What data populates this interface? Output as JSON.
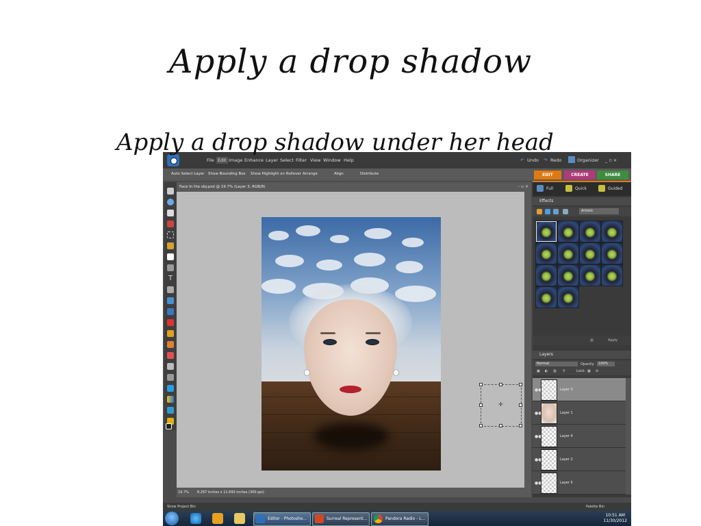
{
  "slide": {
    "title": "Apply a drop shadow",
    "subtitle": "Apply a drop shadow under her head"
  },
  "app": {
    "menu": [
      "File",
      "Edit",
      "Image",
      "Enhance",
      "Layer",
      "Select",
      "Filter",
      "View",
      "Window",
      "Help"
    ],
    "undo": "Undo",
    "redo": "Redo",
    "organizer": "Organizer",
    "win_controls": "_ ▫ ×"
  },
  "options_bar": {
    "auto_select": "Auto Select Layer",
    "show_bounding": "Show Bounding Box",
    "show_highlight": "Show Highlight on Rollover",
    "arrange": "Arrange",
    "align": "Align",
    "distribute": "Distribute"
  },
  "mode_tabs": {
    "edit": "EDIT",
    "create": "CREATE",
    "share": "SHARE"
  },
  "document": {
    "title": "Face In the sky.psd @ 19.7% (Layer 3, RGB/8)",
    "controls": "– ▫ ×",
    "zoom": "19.7%",
    "doc_size": "8.267 inches x 11.693 inches (300 ppi)"
  },
  "panel": {
    "modes": {
      "full": "Full",
      "quick": "Quick",
      "guided": "Guided"
    },
    "effects_header": "Effects",
    "effects_filter": "Artistic",
    "apply": "Apply",
    "layers_header": "Layers",
    "blend_mode": "Normal",
    "opacity_label": "Opacity:",
    "opacity_value": "100%",
    "lock_label": "Lock:",
    "layers": [
      {
        "name": "Layer 3",
        "selected": true,
        "thumb": "transparent"
      },
      {
        "name": "Layer 1",
        "selected": false,
        "thumb": "face"
      },
      {
        "name": "Layer 4",
        "selected": false,
        "thumb": "transparent"
      },
      {
        "name": "Layer 2",
        "selected": false,
        "thumb": "transparent"
      },
      {
        "name": "Layer 5",
        "selected": false,
        "thumb": "transparent"
      }
    ]
  },
  "bottom": {
    "project_bin": "Show Project Bin",
    "palette_bin": "Palette Bin"
  },
  "taskbar": {
    "tasks": [
      "Editor - Photosho...",
      "Surreal Represent...",
      "Pandora Radio - L..."
    ],
    "time": "10:51 AM",
    "date": "11/30/2012"
  }
}
